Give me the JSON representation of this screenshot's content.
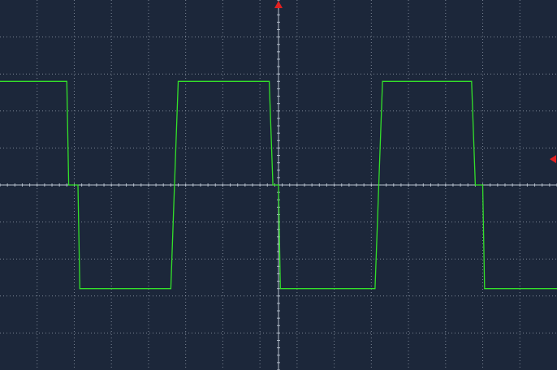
{
  "screen": {
    "background_color": "#1c273a",
    "grid_color": "#c9d3df",
    "trace_color": "#33e02a",
    "marker_color": "#e02020"
  },
  "chart_data": {
    "type": "line",
    "title": "",
    "xlabel": "",
    "ylabel": "",
    "grid": true,
    "divisions": {
      "x": 15,
      "y": 10
    },
    "xlim": [
      0,
      15
    ],
    "ylim": [
      -5,
      5
    ],
    "markers": [
      {
        "name": "trigger-position-marker",
        "shape": "triangle-up",
        "at_x": 7.5
      },
      {
        "name": "trigger-level-marker",
        "shape": "triangle-left",
        "at_y": 0.7
      }
    ],
    "series": [
      {
        "x": [
          0.0,
          1.8,
          1.85,
          1.95,
          2.05,
          2.1,
          2.15,
          4.6,
          4.7,
          4.8,
          7.25,
          7.35,
          7.4,
          7.45,
          7.5,
          7.55,
          10.1,
          10.2,
          10.3,
          12.7,
          12.8,
          12.9,
          13.0,
          13.05,
          15.0
        ],
        "y": [
          2.8,
          2.8,
          0.0,
          0.0,
          0.0,
          0.0,
          -2.8,
          -2.8,
          0.0,
          2.8,
          2.8,
          0.0,
          0.0,
          0.0,
          0.0,
          -2.8,
          -2.8,
          0.0,
          2.8,
          2.8,
          0.0,
          0.0,
          0.0,
          -2.8,
          -2.8
        ]
      }
    ]
  }
}
